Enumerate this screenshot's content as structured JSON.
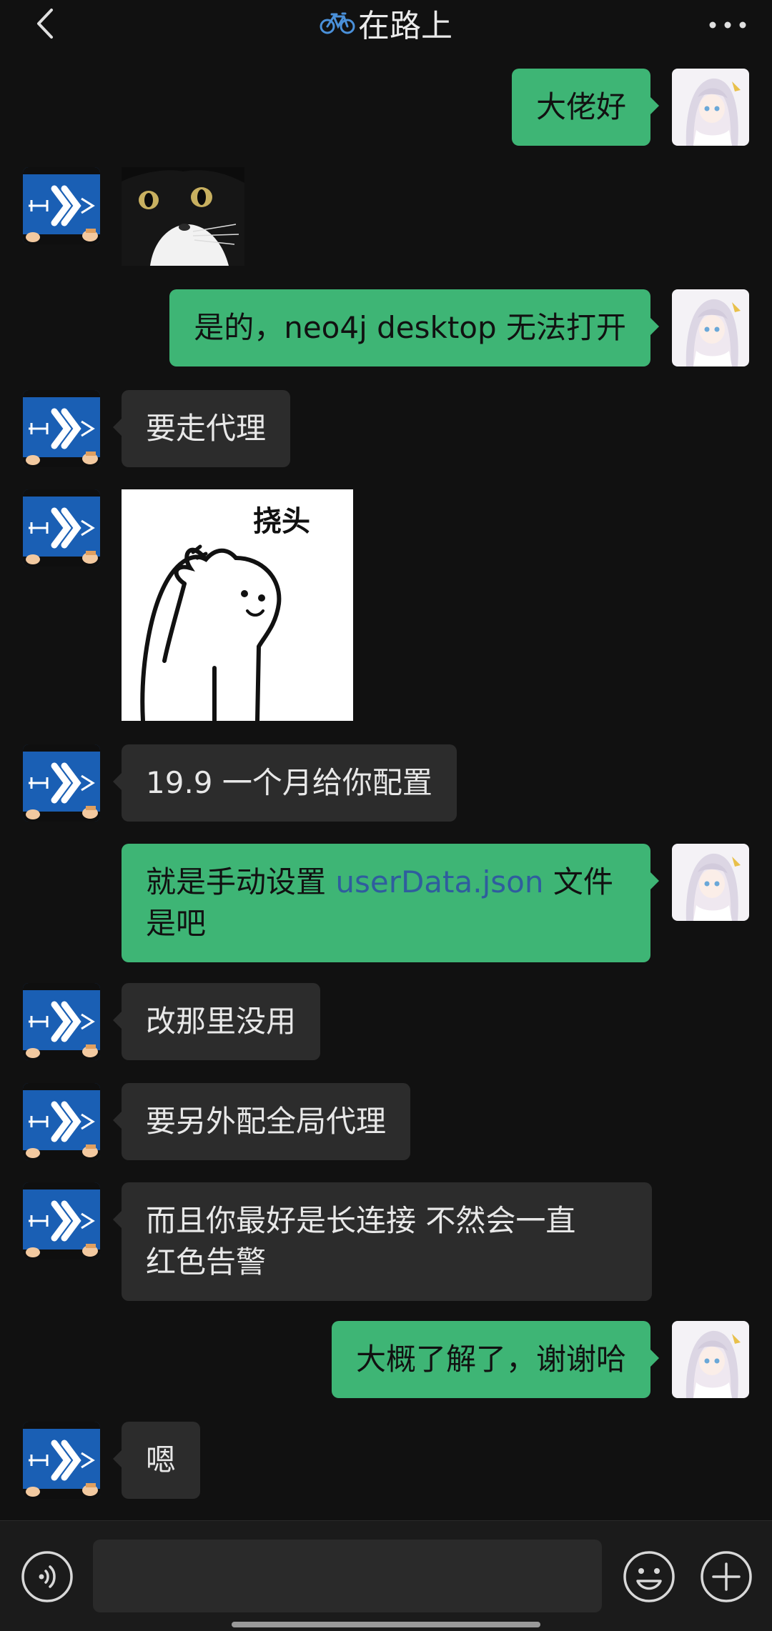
{
  "header": {
    "back_icon": "chevron-left-icon",
    "title_icon": "bicycle-icon",
    "title": "在路上",
    "more_icon": "more-dots-icon"
  },
  "messages": [
    {
      "side": "out",
      "type": "text",
      "text": "大佬好"
    },
    {
      "side": "in",
      "type": "sticker",
      "sticker": "black-cat-sticker"
    },
    {
      "side": "out",
      "type": "text",
      "text": "是的，neo4j desktop 无法打开"
    },
    {
      "side": "in",
      "type": "text",
      "text": "要走代理"
    },
    {
      "side": "in",
      "type": "sticker",
      "sticker": "scratch-head-sticker",
      "caption": "挠头"
    },
    {
      "side": "in",
      "type": "text",
      "text": "19.9 一个月给你配置"
    },
    {
      "side": "out",
      "type": "text",
      "text_before": "就是手动设置 ",
      "link": "userData.json",
      "text_after": " 文件",
      "text_line2": "是吧"
    },
    {
      "side": "in",
      "type": "text",
      "text": "改那里没用"
    },
    {
      "side": "in",
      "type": "text",
      "text": "要另外配全局代理"
    },
    {
      "side": "in",
      "type": "text",
      "text_line1": "而且你最好是长连接 不然会一直",
      "text_line2": "红色告警"
    },
    {
      "side": "out",
      "type": "text",
      "text": "大概了解了，谢谢哈"
    },
    {
      "side": "in",
      "type": "text",
      "text": "嗯"
    }
  ],
  "composer": {
    "voice_icon": "voice-icon",
    "input_value": "",
    "emoji_icon": "emoji-icon",
    "plus_icon": "plus-circle-icon"
  },
  "colors": {
    "background": "#111111",
    "incoming_bubble": "#2c2c2c",
    "outgoing_bubble": "#3eb575",
    "link": "#2f5d9e"
  }
}
